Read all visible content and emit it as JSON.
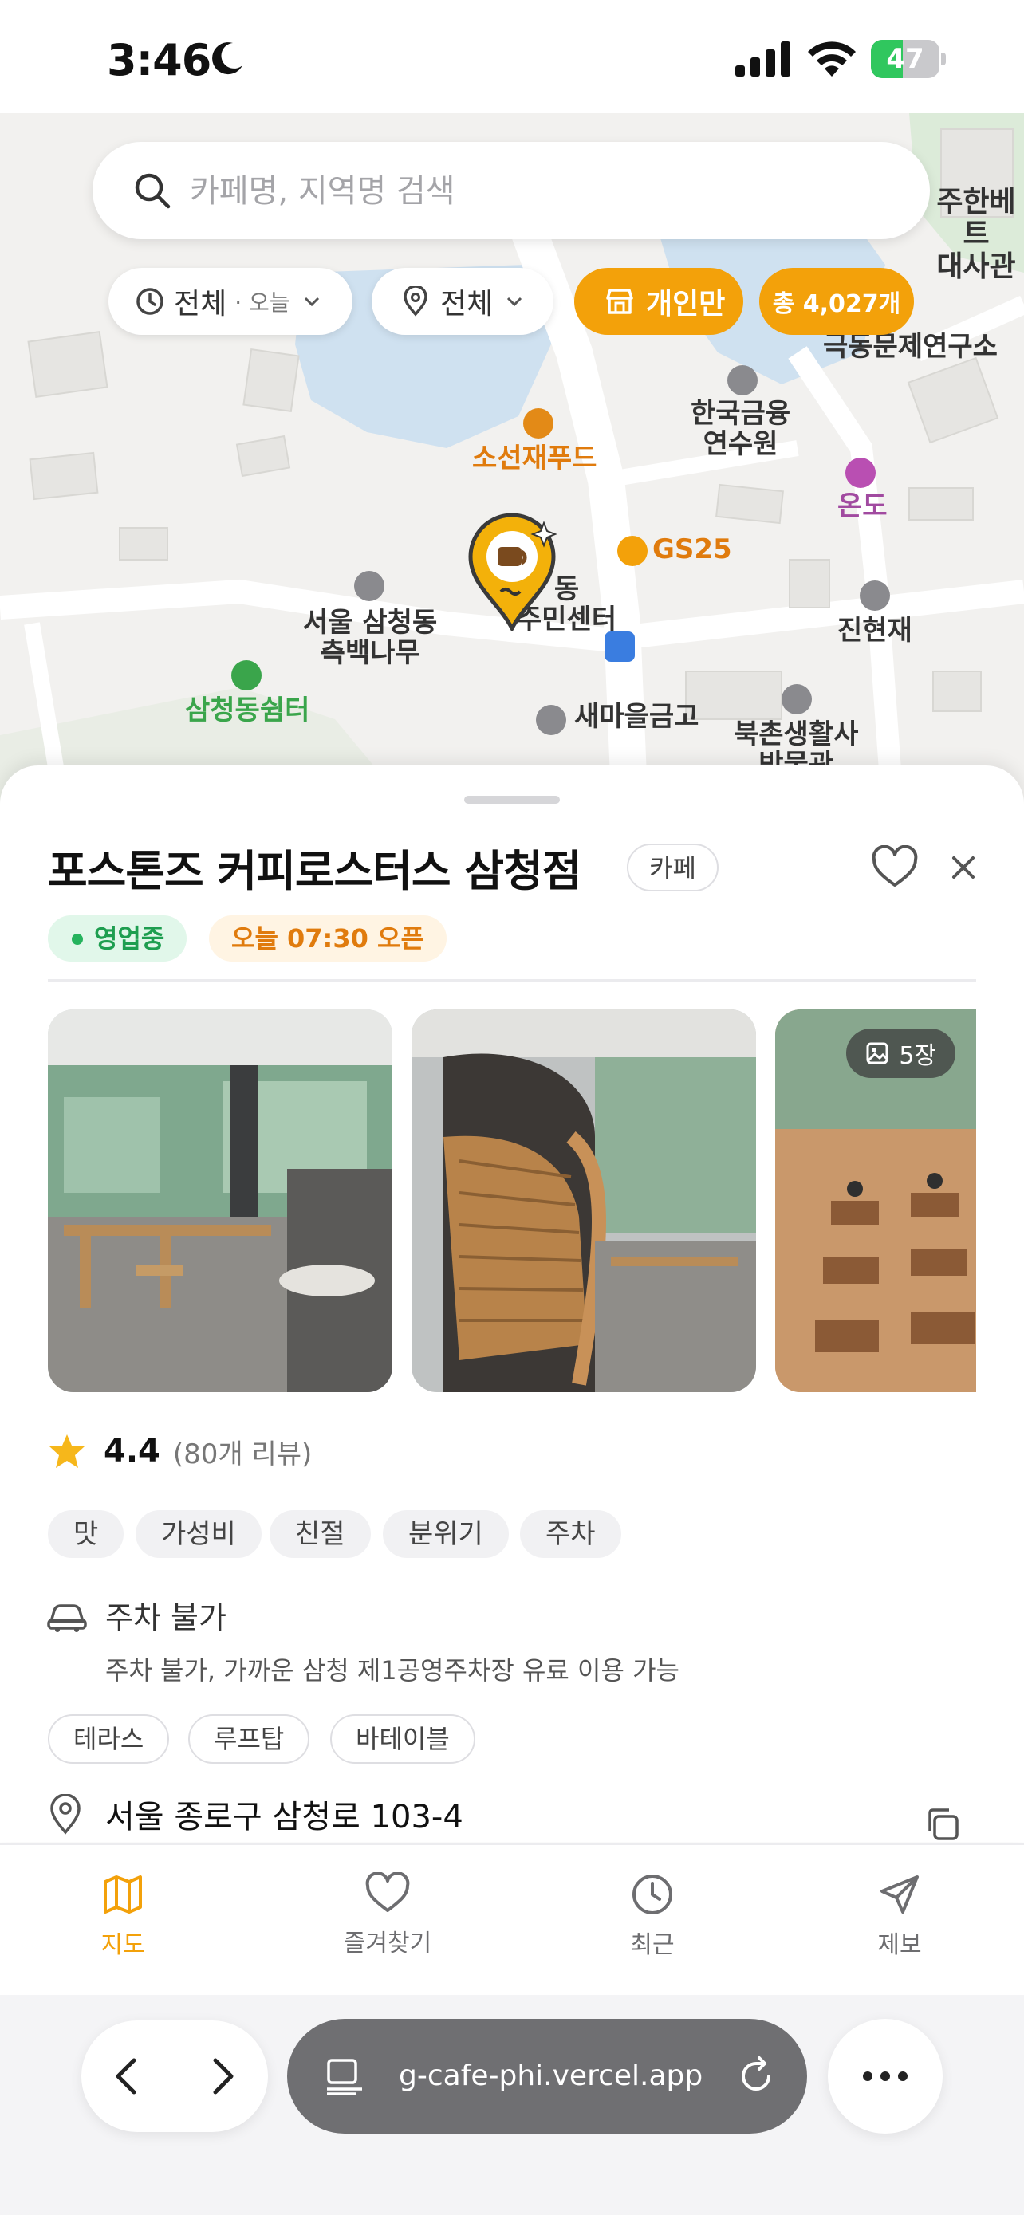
{
  "status_bar": {
    "time": "3:46",
    "battery": "47",
    "battery_level": 0.47
  },
  "map": {
    "search_placeholder": "카페명, 지역명 검색",
    "filters": {
      "time_label": "전체",
      "time_sub": "· 오늘",
      "region_label": "전체",
      "type_label": "개인만",
      "total_label": "총 4,027개"
    },
    "pois": {
      "embassy": "주한베트\n대사관",
      "institute": "대학교\n극동문제연구소",
      "finance": "한국금융\n연수원",
      "sosunjae": "소선재푸드",
      "ondo": "온도",
      "gs25": "GS25",
      "community": "동\n주민센터",
      "jinhyeon": "진현재",
      "cypress": "서울 삼청동\n측백나무",
      "bank": "새마을금고",
      "shelter": "삼청동쉼터",
      "museum": "북촌생활사\n박물관"
    }
  },
  "place": {
    "title": "포스톤즈 커피로스터스 삼청점",
    "category": "카페",
    "status_open": "영업중",
    "status_hours": "오늘 07:30 오픈",
    "photo_count": "5장",
    "rating": "4.4",
    "review_count": "(80개 리뷰)",
    "tags": [
      "맛",
      "가성비",
      "친절",
      "분위기",
      "주차"
    ],
    "parking_title": "주차 불가",
    "parking_desc": "주차 불가, 가까운 삼청 제1공영주차장 유료 이용 가능",
    "features": [
      "테라스",
      "루프탑",
      "바테이블"
    ],
    "address": "서울 종로구 삼청로 103-4"
  },
  "tabs": [
    {
      "label": "지도",
      "icon": "map-icon",
      "active": true
    },
    {
      "label": "즐겨찾기",
      "icon": "heart-icon",
      "active": false
    },
    {
      "label": "최근",
      "icon": "clock-icon",
      "active": false
    },
    {
      "label": "제보",
      "icon": "send-icon",
      "active": false
    }
  ],
  "browser": {
    "url": "g-cafe-phi.vercel.app"
  },
  "colors": {
    "accent": "#f3a10a",
    "open_green": "#1e9e50",
    "hours_orange": "#e07b0d"
  }
}
